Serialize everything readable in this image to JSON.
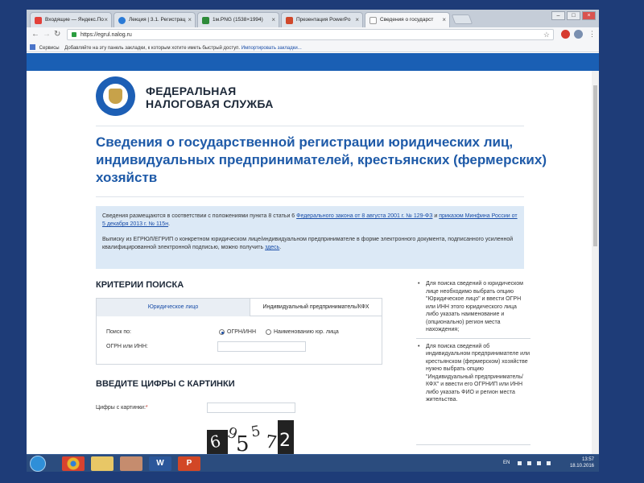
{
  "browser": {
    "tabs": [
      {
        "label": "Входящие — Яндекс.По",
        "icon_color": "#e3403a"
      },
      {
        "label": "Лекция | 3.1. Регистрац",
        "icon_color": "#2a7ad6"
      },
      {
        "label": "1м.PNG (1538×1994)",
        "icon_color": "#2e8b3a"
      },
      {
        "label": "Презентация PowerPo",
        "icon_color": "#d0482b"
      },
      {
        "label": "Сведения о государст",
        "icon_color": "#ffffff"
      }
    ],
    "active_tab": 4,
    "url": "https://egrul.nalog.ru",
    "bookmarks_label": "Сервисы",
    "bookmarks_hint": "Добавляйте на эту панель закладки, к которым хотите иметь быстрый доступ.",
    "bookmarks_import": "Импортировать закладки..."
  },
  "site": {
    "logo_line1": "ФЕДЕРАЛЬНАЯ",
    "logo_line2": "НАЛОГОВАЯ СЛУЖБА",
    "title": "Сведения о государственной регистрации юридических лиц, индивидуальных предпринимателей, крестьянских (фермерских) хозяйств"
  },
  "info": {
    "p1_prefix": "Сведения размещаются в соответствии с положениями пункта 8 статьи 6 ",
    "p1_link1": "Федерального закона от 8 августа 2001 г. № 129-ФЗ",
    "p1_mid": " и ",
    "p1_link2": "приказом Минфина России от 5 декабря 2013 г. № 115н",
    "p1_suffix": ".",
    "p2_text": "Выписку из ЕГРЮЛ/ЕГРИП о конкретном юридическом лице/индивидуальном предпринимателе в форме электронного документа, подписанного усиленной квалифицированной электронной подписью, можно получить ",
    "p2_link": "здесь",
    "p2_suffix": "."
  },
  "search": {
    "heading": "КРИТЕРИИ ПОИСКА",
    "tab_jur": "Юридическое лицо",
    "tab_ip": "Индивидуальный предприниматель/КФХ",
    "search_by_label": "Поиск по:",
    "radio_ogrn": "ОГРН/ИНН",
    "radio_name": "Наименованию юр. лица",
    "ogrn_label": "ОГРН или ИНН:",
    "ogrn_value": ""
  },
  "captcha": {
    "heading": "ВВЕДИТЕ ЦИФРЫ С КАРТИНКИ",
    "label": "Цифры с картинки:",
    "required_mark": "*",
    "value": "",
    "image_digits": [
      "6",
      "9",
      "5",
      "5",
      "7",
      "2"
    ]
  },
  "hints": [
    "Для поиска сведений о юридическом лице необходимо выбрать опцию \"Юридическое лицо\" и ввести ОГРН или ИНН этого юридического лица либо указать наименование и (опционально) регион места нахождения;",
    "Для поиска сведений об индивидуальном предпринимателе или крестьянском (фермерском) хозяйстве нужно выбрать опцию \"Индивидуальный предприниматель/КФХ\" и ввести его ОГРНИП или ИНН либо указать ФИО и регион места жительства."
  ],
  "taskbar": {
    "lang": "EN",
    "time": "13:57",
    "date": "18.10.2016",
    "apps": [
      {
        "name": "chrome-icon",
        "color": "#e9b52e"
      },
      {
        "name": "explorer-icon",
        "color": "#e8c766"
      },
      {
        "name": "user-app-icon",
        "color": "#c58c6e"
      },
      {
        "name": "word-icon",
        "color": "#2b579a"
      },
      {
        "name": "powerpoint-icon",
        "color": "#d24726"
      }
    ]
  }
}
